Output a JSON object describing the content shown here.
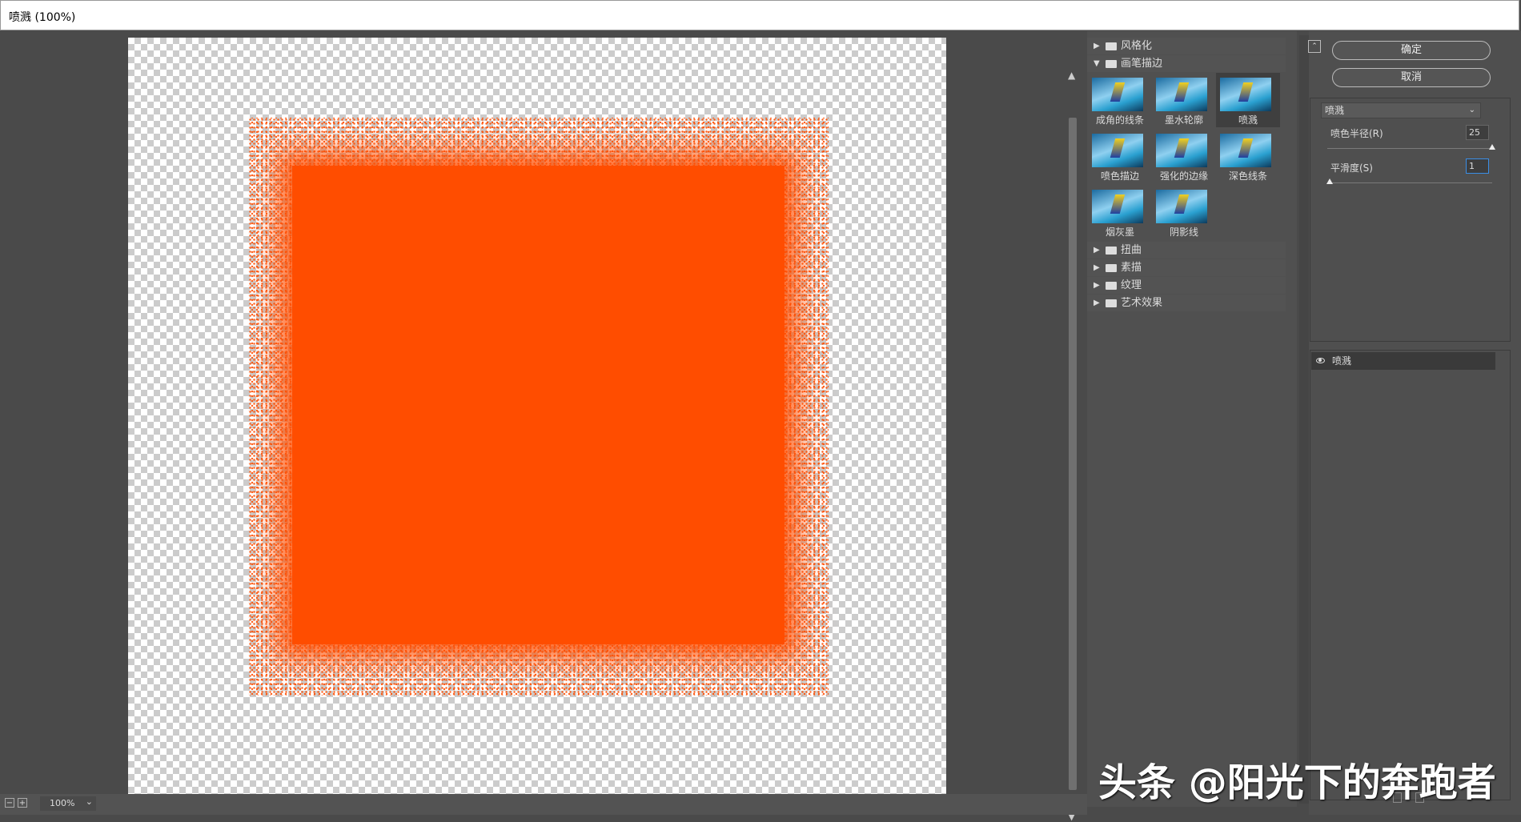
{
  "window": {
    "title": "喷溅 (100%)"
  },
  "preview": {
    "zoom": "100%",
    "zoom_out": "−",
    "zoom_in": "+",
    "zoom_dropdown": "⌄",
    "scroll_up": "▲",
    "scroll_down": "▼"
  },
  "gallery": {
    "categories_top": [
      {
        "label": "风格化",
        "expanded": false
      },
      {
        "label": "画笔描边",
        "expanded": true
      }
    ],
    "filters": [
      {
        "label": "成角的线条"
      },
      {
        "label": "墨水轮廓"
      },
      {
        "label": "喷溅",
        "selected": true
      },
      {
        "label": "喷色描边"
      },
      {
        "label": "强化的边缘"
      },
      {
        "label": "深色线条"
      },
      {
        "label": "烟灰墨"
      },
      {
        "label": "阴影线"
      }
    ],
    "categories_bottom": [
      {
        "label": "扭曲"
      },
      {
        "label": "素描"
      },
      {
        "label": "纹理"
      },
      {
        "label": "艺术效果"
      }
    ],
    "collapsed_glyph": "▶",
    "expanded_glyph": "▼"
  },
  "settings": {
    "ok_label": "确定",
    "cancel_label": "取消",
    "collapse_glyph": "⌃",
    "filter_select": "喷溅",
    "select_chevron": "⌄",
    "params": [
      {
        "label": "喷色半径(R)",
        "value": "25",
        "slider_fraction": 1.0
      },
      {
        "label": "平滑度(S)",
        "value": "1",
        "slider_fraction": 0.0
      }
    ]
  },
  "layers": [
    {
      "name": "喷溅",
      "visible": true
    }
  ],
  "watermark": "头条 @阳光下的奔跑者",
  "colors": {
    "paint": "#ff4d00",
    "accent": "#3a8ee6"
  }
}
